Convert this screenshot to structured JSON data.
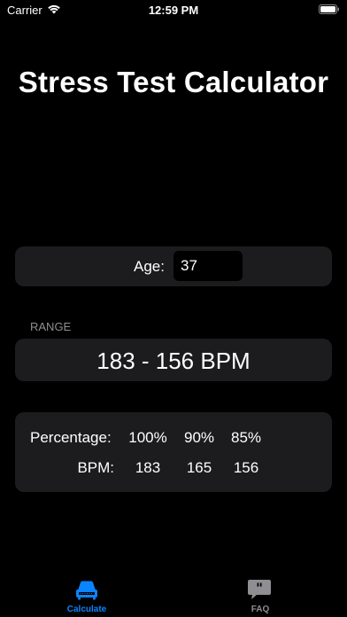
{
  "status_bar": {
    "carrier": "Carrier",
    "time": "12:59 PM"
  },
  "title": "Stress Test Calculator",
  "age": {
    "label": "Age:",
    "value": "37"
  },
  "range": {
    "header": "RANGE",
    "value": "183 - 156 BPM"
  },
  "table": {
    "percentage_label": "Percentage:",
    "percentages": [
      "100%",
      "90%",
      "85%"
    ],
    "bpm_label": "BPM:",
    "bpm_values": [
      "183",
      "165",
      "156"
    ]
  },
  "tabs": [
    {
      "label": "Calculate",
      "icon": "monitor-icon",
      "selected": true
    },
    {
      "label": "FAQ",
      "icon": "quote-bubble-icon",
      "selected": false
    }
  ],
  "colors": {
    "background": "#000000",
    "card": "#1c1c1e",
    "accent": "#0a84ff",
    "secondary_text": "#8e8e93"
  }
}
